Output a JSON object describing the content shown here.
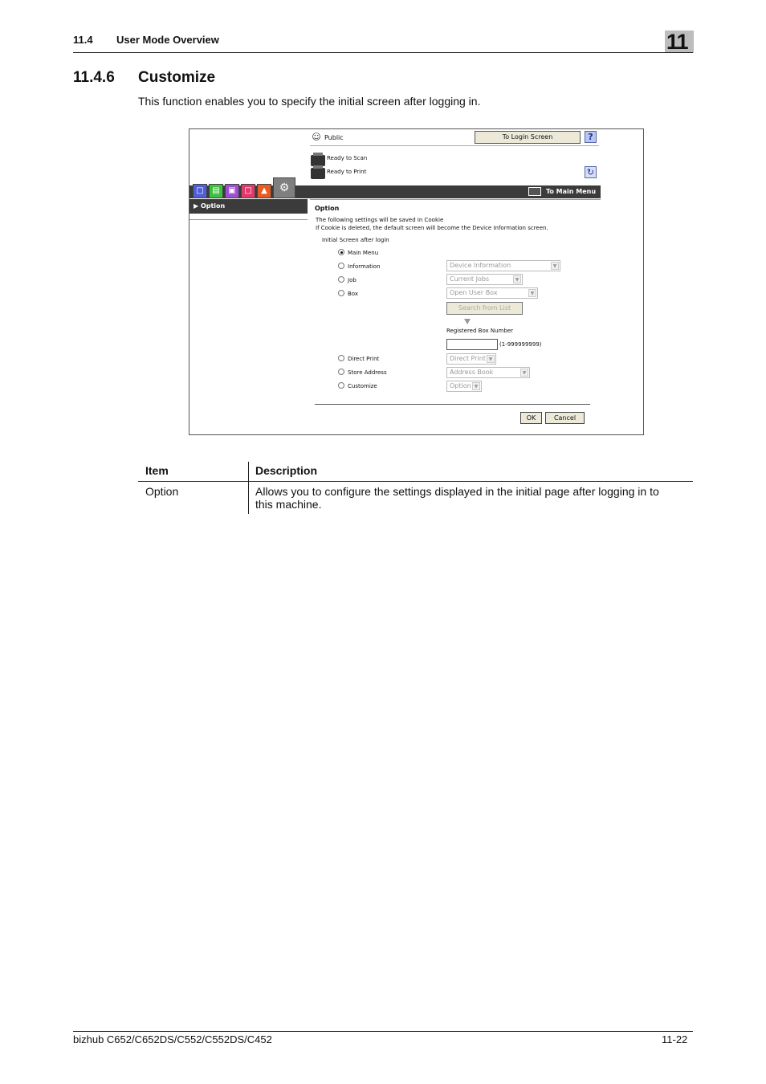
{
  "header": {
    "section_number": "11.4",
    "section_title": "User Mode Overview",
    "chapter": "11"
  },
  "heading": {
    "number": "11.4.6",
    "title": "Customize"
  },
  "intro": "This function enables you to specify the initial screen after logging in.",
  "screen": {
    "user_label": "Public",
    "login_button": "To Login Screen",
    "help_label": "?",
    "status_scan": "Ready to Scan",
    "status_print": "Ready to Print",
    "to_main_menu": "To Main Menu",
    "side_option": "Option",
    "panel_title": "Option",
    "note_line1": "The following settings will be saved in Cookie",
    "note_line2": "If Cookie is deleted, the default screen will become the Device Information screen.",
    "initial_screen_label": "Initial Screen after login",
    "options": [
      {
        "label": "Main Menu",
        "checked": true
      },
      {
        "label": "Information",
        "select": "Device Information"
      },
      {
        "label": "Job",
        "select": "Current Jobs"
      },
      {
        "label": "Box",
        "select": "Open User Box"
      },
      {
        "label": "Direct Print",
        "select": "Direct Print"
      },
      {
        "label": "Store Address",
        "select": "Address Book"
      },
      {
        "label": "Customize",
        "select": "Option"
      }
    ],
    "search_from_list": "Search from List",
    "registered_box_label": "Registered Box Number",
    "box_range": "(1-999999999)",
    "ok_button": "OK",
    "cancel_button": "Cancel"
  },
  "table": {
    "headers": [
      "Item",
      "Description"
    ],
    "rows": [
      {
        "item": "Option",
        "description_line1": "Allows you to configure the settings displayed in the initial page after logging in to",
        "description_line2": "this machine."
      }
    ]
  },
  "footer": {
    "model": "bizhub C652/C652DS/C552/C552DS/C452",
    "page": "11-22"
  }
}
